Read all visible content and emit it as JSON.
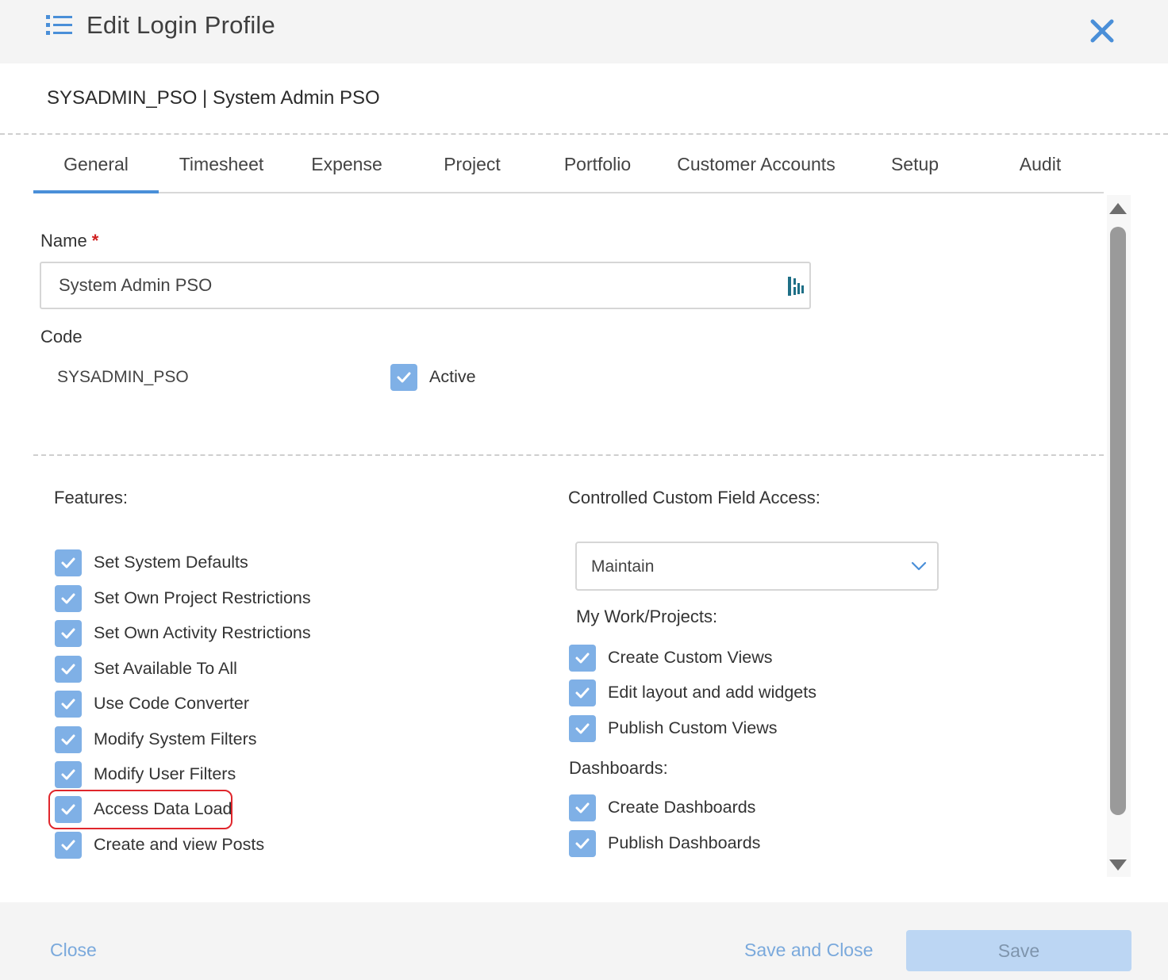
{
  "dialog": {
    "title": "Edit Login Profile",
    "subtitle": "SYSADMIN_PSO | System Admin PSO"
  },
  "tabs": [
    {
      "label": "General",
      "active": true
    },
    {
      "label": "Timesheet"
    },
    {
      "label": "Expense"
    },
    {
      "label": "Project"
    },
    {
      "label": "Portfolio"
    },
    {
      "label": "Customer Accounts"
    },
    {
      "label": "Setup"
    },
    {
      "label": "Audit"
    }
  ],
  "form": {
    "name_label": "Name",
    "required_mark": "*",
    "name_value": "System Admin PSO",
    "code_label": "Code",
    "code_value": "SYSADMIN_PSO",
    "active_label": "Active",
    "active_checked": true
  },
  "features": {
    "heading": "Features:",
    "items": [
      {
        "label": "Set System Defaults",
        "checked": true
      },
      {
        "label": "Set Own Project Restrictions",
        "checked": true
      },
      {
        "label": "Set Own Activity Restrictions",
        "checked": true
      },
      {
        "label": "Set Available To All",
        "checked": true
      },
      {
        "label": "Use Code Converter",
        "checked": true
      },
      {
        "label": "Modify System Filters",
        "checked": true
      },
      {
        "label": "Modify User Filters",
        "checked": true
      },
      {
        "label": "Access Data Load",
        "checked": true,
        "highlighted": true
      },
      {
        "label": "Create and view Posts",
        "checked": true
      }
    ]
  },
  "custom_field_access": {
    "heading": "Controlled Custom Field Access:",
    "selected": "Maintain"
  },
  "my_work": {
    "heading": "My Work/Projects:",
    "items": [
      {
        "label": "Create Custom Views",
        "checked": true
      },
      {
        "label": "Edit layout and add widgets",
        "checked": true
      },
      {
        "label": "Publish Custom Views",
        "checked": true
      }
    ]
  },
  "dashboards": {
    "heading": "Dashboards:",
    "items": [
      {
        "label": "Create Dashboards",
        "checked": true
      },
      {
        "label": "Publish Dashboards",
        "checked": true
      }
    ]
  },
  "footer": {
    "close_label": "Close",
    "save_close_label": "Save and Close",
    "save_label": "Save"
  },
  "colors": {
    "accent": "#4a8fd8",
    "checkbox": "#7fb0e6",
    "highlight": "#e0262c",
    "save_button": "#bcd6f3"
  },
  "icons": {
    "menu": "list-icon",
    "close": "close-icon",
    "name_field": "translate-icon",
    "select": "chevron-down-icon",
    "checkbox": "check-icon"
  }
}
